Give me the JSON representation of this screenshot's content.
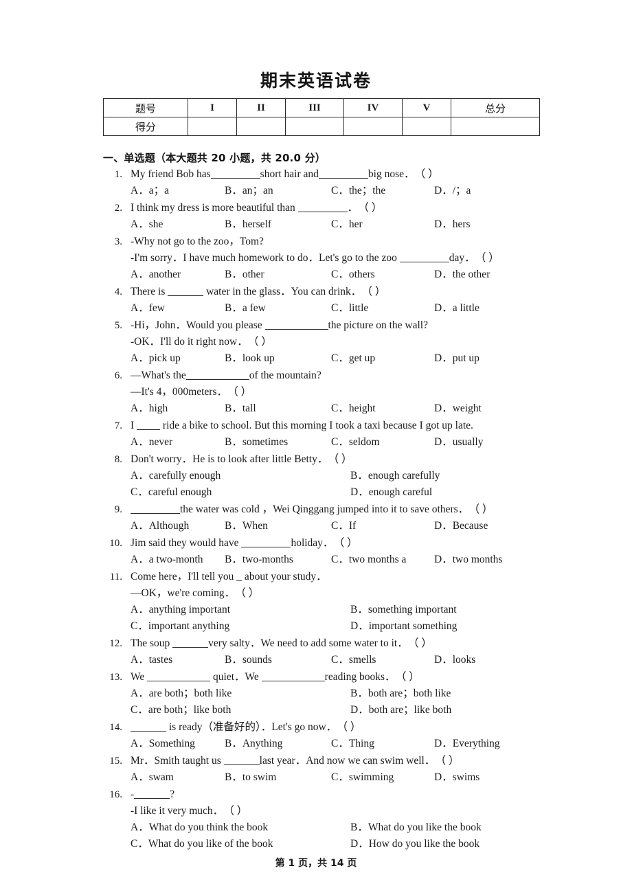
{
  "document": {
    "title": "期末英语试卷",
    "footer": "第 1 页，共 14 页"
  },
  "score_table": {
    "row_labels": [
      "题号",
      "得分"
    ],
    "columns": [
      "I",
      "II",
      "III",
      "IV",
      "V",
      "总分"
    ],
    "scores": [
      "",
      "",
      "",
      "",
      "",
      ""
    ]
  },
  "section": {
    "heading": "一、单选题（本大题共 20 小题，共 20.0 分）"
  },
  "questions": [
    {
      "number": "1.",
      "lines": [
        "My friend Bob has",
        "short hair and",
        "big nose．"
      ],
      "stem_pre": "My friend Bob has",
      "stem_mid": "short hair and",
      "stem_post": "big nose．",
      "options": [
        "A．a；a",
        "B．an；an",
        "C．the；the",
        "D．/；a"
      ],
      "layout": "4col"
    },
    {
      "number": "2.",
      "stem_pre": "I think my dress is more beautiful than",
      "stem_post": "．",
      "options": [
        "A．she",
        "B．herself",
        "C．her",
        "D．hers"
      ],
      "layout": "4col"
    },
    {
      "number": "3.",
      "line1": "-Why not go to the zoo，Tom?",
      "line2_pre": "-I'm sorry．I have much homework to do．Let's go to the zoo",
      "line2_post": "day．",
      "options": [
        "A．another",
        "B．other",
        "C．others",
        "D．the other"
      ],
      "layout": "4col"
    },
    {
      "number": "4.",
      "stem_pre": "There is",
      "stem_post": "water in the glass．You can drink．",
      "options": [
        "A．few",
        "B．a few",
        "C．little",
        "D．a little"
      ],
      "layout": "4col"
    },
    {
      "number": "5.",
      "line1_pre": "-Hi，John．Would you please",
      "line1_post": "the picture on the wall?",
      "line2": "-OK．I'll do it right now．",
      "options": [
        "A．pick up",
        "B．look up",
        "C．get up",
        "D．put up"
      ],
      "layout": "4col"
    },
    {
      "number": "6.",
      "line1_pre": "—What's the",
      "line1_post": "of the mountain?",
      "line2": "—It's 4，000meters．",
      "options": [
        "A．high",
        "B．tall",
        "C．height",
        "D．weight"
      ],
      "layout": "4col"
    },
    {
      "number": "7.",
      "stem_pre": "I",
      "stem_post": "ride a bike to school. But this morning I took a taxi because I got up late.",
      "options": [
        "A．never",
        "B．sometimes",
        "C．seldom",
        "D．usually"
      ],
      "layout": "4col"
    },
    {
      "number": "8.",
      "stem": "Don't worry．He is to look after little Betty．",
      "options": [
        "A．carefully enough",
        "B．enough carefully",
        "C．careful enough",
        "D．enough careful"
      ],
      "layout": "2col"
    },
    {
      "number": "9.",
      "stem_pre": "",
      "stem_post": "the water was cold ，Wei Qinggang jumped into it to save others．",
      "options": [
        "A．Although",
        "B．When",
        "C．If",
        "D．Because"
      ],
      "layout": "4col"
    },
    {
      "number": "10.",
      "stem_pre": "Jim said they would have",
      "stem_post": "holiday．",
      "options": [
        "A．a two-month",
        "B．two-months",
        "C．two months a",
        "D．two months"
      ],
      "layout": "4col"
    },
    {
      "number": "11.",
      "line1": "Come here，I'll tell you _ about your study．",
      "line2": "—OK，we're coming．",
      "options": [
        "A．anything important",
        "B．something important",
        "C．important anything",
        "D．important something"
      ],
      "layout": "2col"
    },
    {
      "number": "12.",
      "stem_pre": "The soup",
      "stem_post": "very salty．We need to add some water to it．",
      "options": [
        "A．tastes",
        "B．sounds",
        "C．smells",
        "D．looks"
      ],
      "layout": "4col"
    },
    {
      "number": "13.",
      "stem_pre": "We",
      "stem_mid": "quiet．We",
      "stem_post": "reading books．",
      "options": [
        "A．are both；both like",
        "B．both are；both like",
        "C．are both；like both",
        "D．both are；like both"
      ],
      "layout": "2col"
    },
    {
      "number": "14.",
      "stem_pre": "",
      "stem_post": "is ready（准备好的）．Let's go now．",
      "options": [
        "A．Something",
        "B．Anything",
        "C．Thing",
        "D．Everything"
      ],
      "layout": "4col"
    },
    {
      "number": "15.",
      "stem_pre": "Mr．Smith taught us",
      "stem_post": "last year．And now we can swim well．",
      "options": [
        "A．swam",
        "B．to swim",
        "C．swimming",
        "D．swims"
      ],
      "layout": "4col"
    },
    {
      "number": "16.",
      "line1_pre": "-",
      "line1_post": "?",
      "line2": "-I like it very much．",
      "options": [
        "A．What do you think the book",
        "B．What do you like the book",
        "C．What do you like of the book",
        "D．How do you like the book"
      ],
      "layout": "2col"
    }
  ],
  "marks": {
    "answer_paren": "（      ）"
  }
}
